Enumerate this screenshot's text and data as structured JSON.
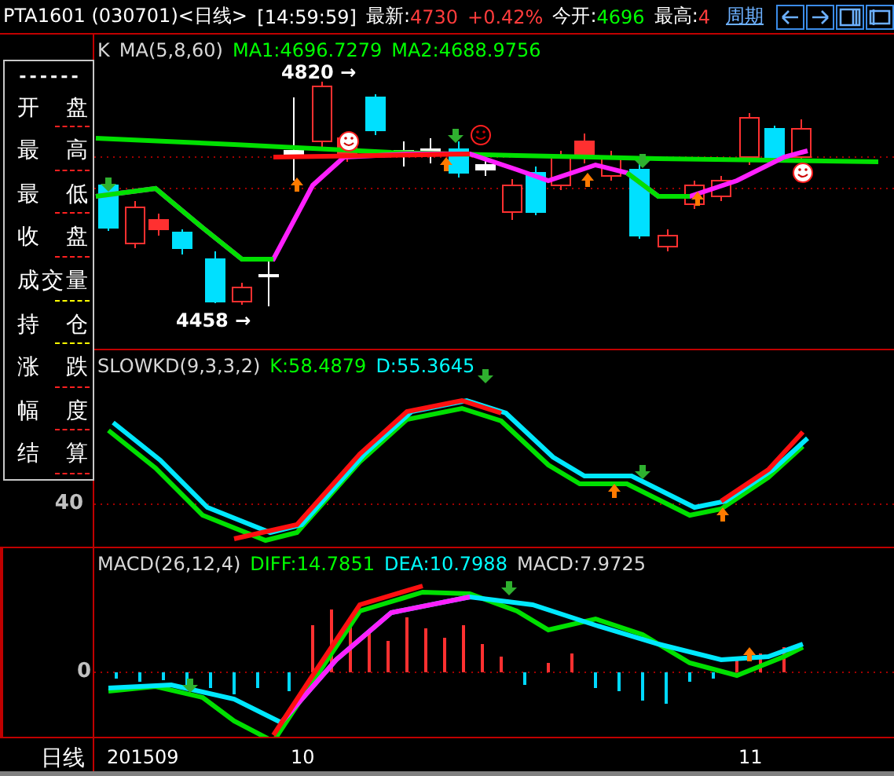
{
  "header": {
    "symbol": "PTA1601 (030701)<日线>",
    "time": "[14:59:59]",
    "quotes": [
      {
        "label": "最新:",
        "value": "4730",
        "change": "+0.42%",
        "color": "#ff3c3c"
      },
      {
        "label": "今开:",
        "value": "4696",
        "color": "#00ff00"
      },
      {
        "label": "最高:",
        "value": "4",
        "color": "#ff3c3c"
      }
    ],
    "period_link": "周期"
  },
  "sidebar": {
    "heading": "------",
    "items": [
      {
        "label": "开 盘",
        "color": "#ff2020"
      },
      {
        "label": "最 高",
        "color": "#ff2020"
      },
      {
        "label": "最 低",
        "color": "#ff2020"
      },
      {
        "label": "收 盘",
        "color": "#ff2020"
      },
      {
        "label": "成交量",
        "color": "#ffff00"
      },
      {
        "label": "持 仓",
        "color": "#ffff00"
      },
      {
        "label": "涨 跌",
        "color": "#ff2020"
      },
      {
        "label": "幅 度",
        "color": "#ff2020"
      },
      {
        "label": "结 算",
        "color": "#ff2020"
      }
    ]
  },
  "kline": {
    "title": "K",
    "indicator": "MA(5,8,60)",
    "values": [
      {
        "text": "MA1:4696.7279",
        "color": "#00ff00"
      },
      {
        "text": "MA2:4688.9756",
        "color": "#00ff00"
      }
    ],
    "high_label": "4820 →",
    "low_label": "4458 →"
  },
  "kd": {
    "indicator": "SLOWKD(9,3,3,2)",
    "values": [
      {
        "text": "K:58.4879",
        "color": "#00ff00"
      },
      {
        "text": "D:55.3645",
        "color": "#00ffff"
      }
    ],
    "y_tick": "40"
  },
  "macd": {
    "indicator": "MACD(26,12,4)",
    "values": [
      {
        "text": "DIFF:14.7851",
        "color": "#00ff00"
      },
      {
        "text": "DEA:10.7988",
        "color": "#00ffff"
      },
      {
        "text": "MACD:7.9725",
        "color": "#d8d8d8"
      }
    ],
    "y_tick": "0"
  },
  "x_axis": {
    "label": "日线",
    "ticks": [
      "201509",
      "10",
      "11"
    ]
  }
}
